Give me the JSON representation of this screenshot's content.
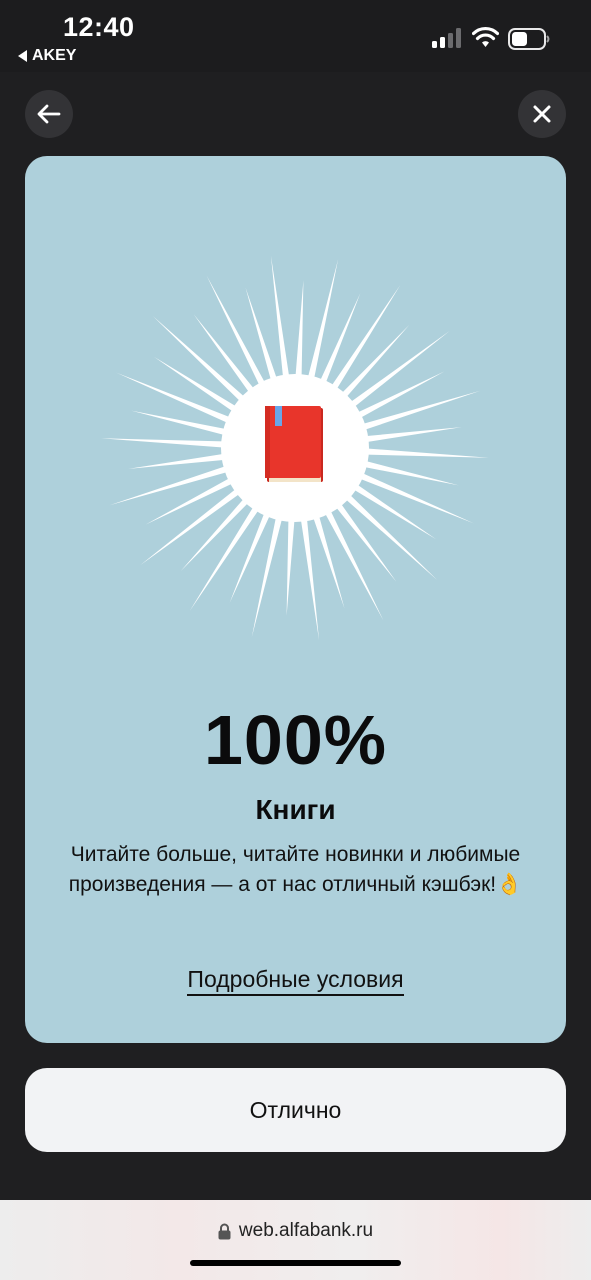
{
  "status_bar": {
    "time": "12:40",
    "back_app_label": "AKEY"
  },
  "nav": {
    "back_icon": "arrow-left-icon",
    "close_icon": "close-icon"
  },
  "card": {
    "background_color": "#aed0db",
    "illustration": "book-icon",
    "percent": "100%",
    "title": "Книги",
    "description": "Читайте больше, читайте новинки и любимые произведения — а от нас отличный кэшбэк!👌",
    "details_link": "Подробные условия"
  },
  "primary_button": {
    "label": "Отлично"
  },
  "browser": {
    "url": "web.alfabank.ru"
  },
  "colors": {
    "background": "#1f1f21",
    "card": "#aed0db",
    "button": "#f2f3f5",
    "book_red": "#e8352b",
    "bookmark_blue": "#6aa6e8"
  }
}
